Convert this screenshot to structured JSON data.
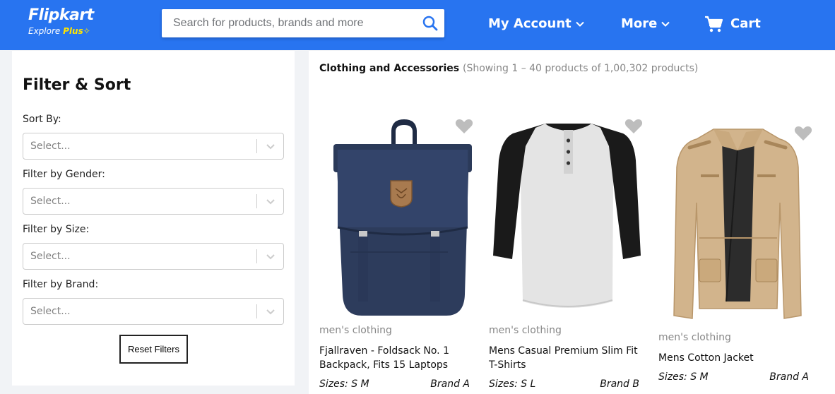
{
  "header": {
    "brand": "Flipkart",
    "tagline_prefix": "Explore",
    "tagline_plus": "Plus",
    "search": {
      "placeholder": "Search for products, brands and more",
      "value": ""
    },
    "nav": {
      "account": "My Account",
      "more": "More",
      "cart": "Cart"
    },
    "colors": {
      "primary": "#2874f0",
      "plus": "#ffe500"
    }
  },
  "sidebar": {
    "title": "Filter & Sort",
    "filters": [
      {
        "label": "Sort By:",
        "selected": "Select..."
      },
      {
        "label": "Filter by Gender:",
        "selected": "Select..."
      },
      {
        "label": "Filter by Size:",
        "selected": "Select..."
      },
      {
        "label": "Filter by Brand:",
        "selected": "Select..."
      }
    ],
    "reset_label": "Reset Filters"
  },
  "main": {
    "title": "Clothing and Accessories",
    "count_text": "(Showing 1 – 40 products of 1,00,302 products)",
    "products": [
      {
        "category": "men's clothing",
        "name": "Fjallraven - Foldsack No. 1 Backpack, Fits 15 Laptops",
        "sizes": "Sizes: S M",
        "brand": "Brand A",
        "image": "backpack"
      },
      {
        "category": "men's clothing",
        "name": "Mens Casual Premium Slim Fit T-Shirts",
        "sizes": "Sizes: S L",
        "brand": "Brand B",
        "image": "raglan-tshirt"
      },
      {
        "category": "men's clothing",
        "name": "Mens Cotton Jacket",
        "sizes": "Sizes: S M",
        "brand": "Brand A",
        "image": "cotton-jacket"
      }
    ]
  }
}
